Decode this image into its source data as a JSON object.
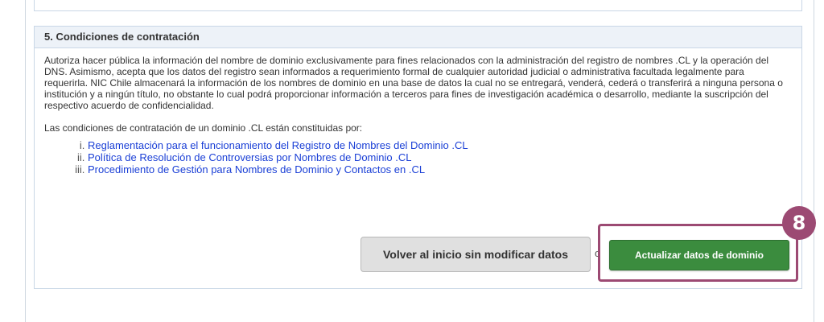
{
  "section": {
    "title": "5. Condiciones de contratación",
    "paragraph": "Autoriza hacer pública la información del nombre de dominio exclusivamente para fines relacionados con la administración del registro de nombres .CL y la operación del DNS. Asimismo, acepta que los datos del registro sean informados a requerimiento formal de cualquier autoridad judicial o administrativa facultada legalmente para requerirla. NIC Chile almacenará la información de los nombres de dominio en una base de datos la cual no se entregará, venderá, cederá o transferirá a ninguna persona o institución y a ningún título, no obstante lo cual podrá proporcionar información a terceros para fines de investigación académica o desarrollo, mediante la suscripción del respectivo acuerdo de confidencialidad.",
    "intro": "Las condiciones de contratación de un dominio .CL están constituidas por:",
    "links": [
      {
        "label": "Reglamentación para el funcionamiento del Registro de Nombres del Dominio .CL"
      },
      {
        "label": "Política de Resolución de Controversias por Nombres de Dominio .CL"
      },
      {
        "label": "Procedimiento de Gestión para Nombres de Dominio y Contactos en .CL"
      }
    ]
  },
  "actions": {
    "back_label": "Volver al inicio sin modificar datos",
    "or_label": "o",
    "update_label": "Actualizar datos de dominio"
  },
  "annotation": {
    "step_number": "8",
    "color": "#9c4a73"
  },
  "colors": {
    "update_button": "#3b8c3e",
    "link": "#1a3fd6",
    "panel_header_bg": "#edf2f8"
  }
}
